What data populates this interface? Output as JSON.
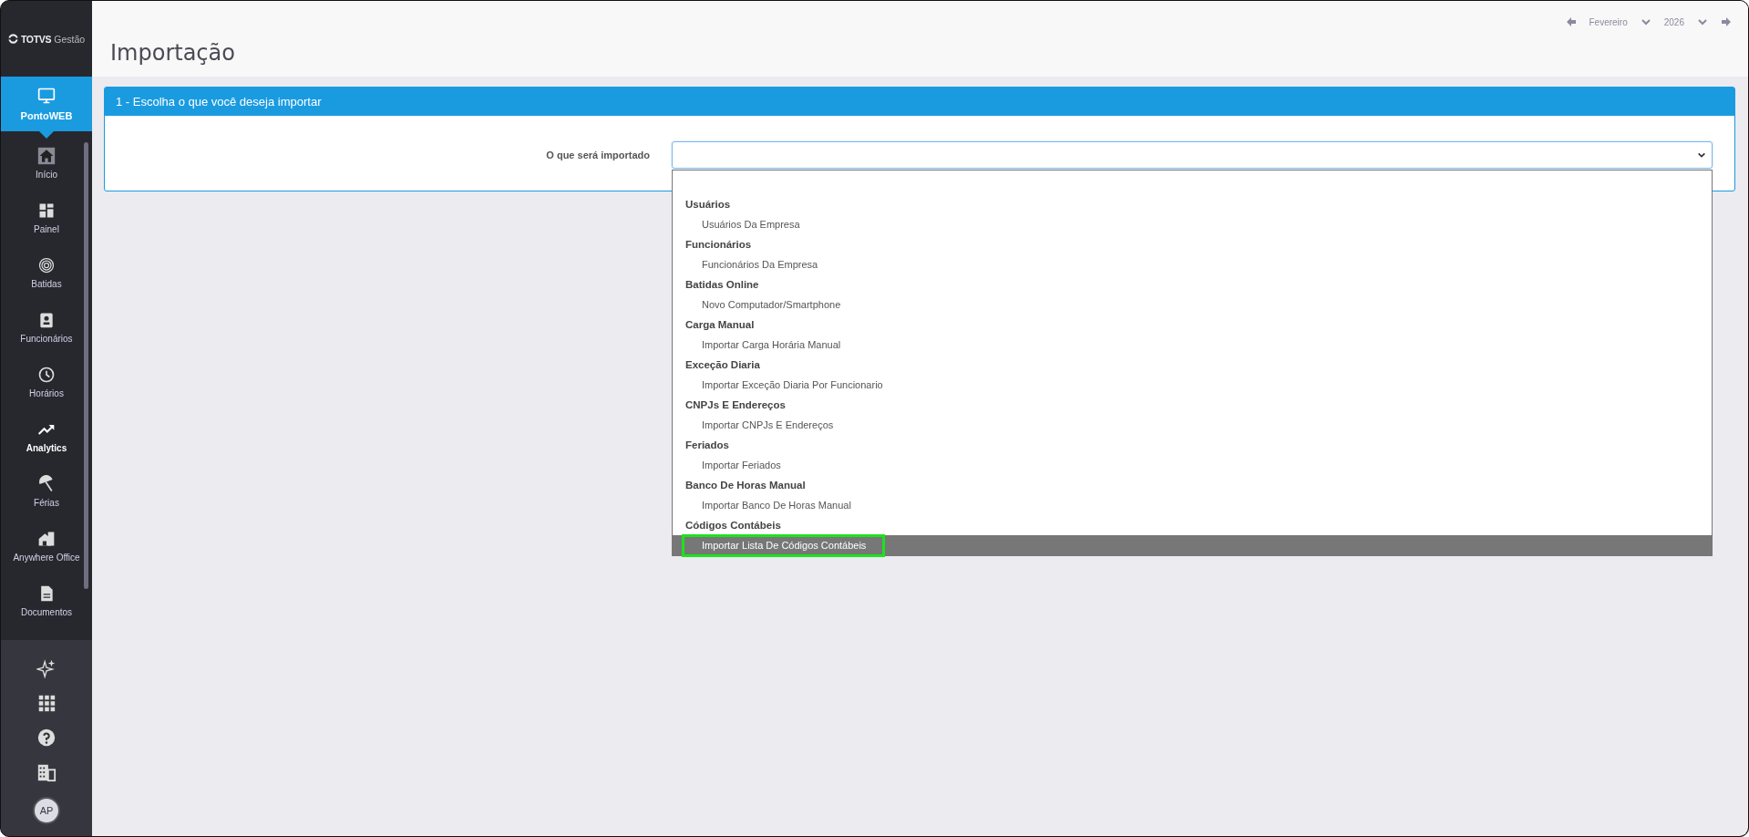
{
  "sidebar": {
    "logo": {
      "brand": "TOTVS",
      "product": "Gestão"
    },
    "module": {
      "label": "PontoWEB",
      "selected": true
    },
    "items": [
      {
        "label": "Início",
        "selected": false
      },
      {
        "label": "Painel",
        "selected": false
      },
      {
        "label": "Batidas",
        "selected": false
      },
      {
        "label": "Funcionários",
        "selected": false
      },
      {
        "label": "Horários",
        "selected": false
      },
      {
        "label": "Analytics",
        "selected": true
      },
      {
        "label": "Férias",
        "selected": false
      },
      {
        "label": "Anywhere Office",
        "selected": false
      },
      {
        "label": "Documentos",
        "selected": false
      }
    ],
    "avatar": "AP"
  },
  "header": {
    "title": "Importação",
    "month": "Fevereiro",
    "year": "2026"
  },
  "panel": {
    "title": "1 - Escolha o que você deseja importar",
    "field_label": "O que será importado",
    "options": [
      {
        "kind": "group",
        "label": "Usuários"
      },
      {
        "kind": "option",
        "label": "Usuários Da Empresa",
        "selected": false
      },
      {
        "kind": "group",
        "label": "Funcionários"
      },
      {
        "kind": "option",
        "label": "Funcionários Da Empresa",
        "selected": false
      },
      {
        "kind": "group",
        "label": "Batidas Online"
      },
      {
        "kind": "option",
        "label": "Novo Computador/Smartphone",
        "selected": false
      },
      {
        "kind": "group",
        "label": "Carga Manual"
      },
      {
        "kind": "option",
        "label": "Importar Carga Horária Manual",
        "selected": false
      },
      {
        "kind": "group",
        "label": "Exceção Diaria"
      },
      {
        "kind": "option",
        "label": "Importar Exceção Diaria Por Funcionario",
        "selected": false
      },
      {
        "kind": "group",
        "label": "CNPJs E Endereços"
      },
      {
        "kind": "option",
        "label": "Importar CNPJs E Endereços",
        "selected": false
      },
      {
        "kind": "group",
        "label": "Feriados"
      },
      {
        "kind": "option",
        "label": "Importar Feriados",
        "selected": false
      },
      {
        "kind": "group",
        "label": "Banco De Horas Manual"
      },
      {
        "kind": "option",
        "label": "Importar Banco De Horas Manual",
        "selected": false
      },
      {
        "kind": "group",
        "label": "Códigos Contábeis"
      },
      {
        "kind": "option",
        "label": "Importar Lista De Códigos Contábeis",
        "selected": true,
        "highlighted": true
      }
    ]
  }
}
